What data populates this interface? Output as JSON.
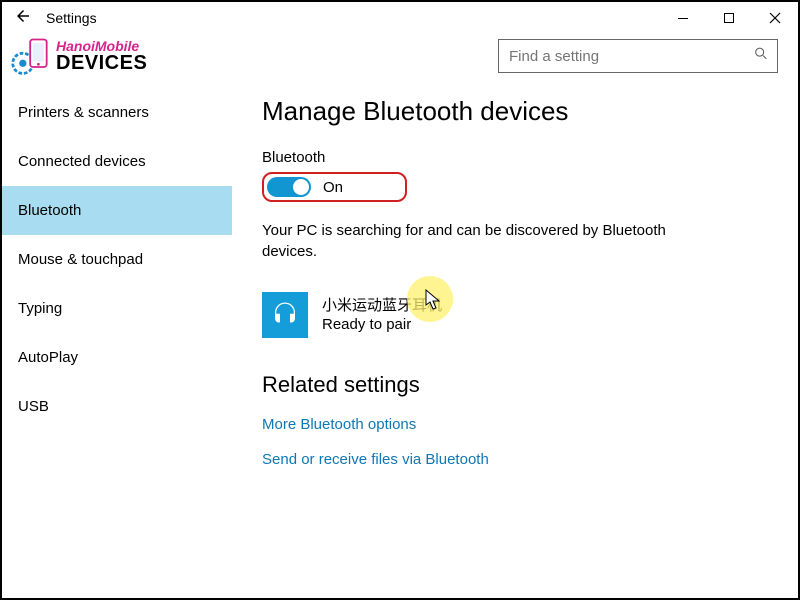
{
  "window": {
    "title": "Settings"
  },
  "logo": {
    "brand": "HanoiMobile",
    "section": "DEVICES"
  },
  "search": {
    "placeholder": "Find a setting"
  },
  "sidebar": {
    "items": [
      {
        "label": "Printers & scanners",
        "selected": false
      },
      {
        "label": "Connected devices",
        "selected": false
      },
      {
        "label": "Bluetooth",
        "selected": true
      },
      {
        "label": "Mouse & touchpad",
        "selected": false
      },
      {
        "label": "Typing",
        "selected": false
      },
      {
        "label": "AutoPlay",
        "selected": false
      },
      {
        "label": "USB",
        "selected": false
      }
    ]
  },
  "main": {
    "heading": "Manage Bluetooth devices",
    "toggle_label": "Bluetooth",
    "toggle_state": "On",
    "status": "Your PC is searching for and can be discovered by Bluetooth devices.",
    "device": {
      "name": "小米运动蓝牙耳机",
      "status": "Ready to pair"
    },
    "related_heading": "Related settings",
    "links": {
      "more_options": "More Bluetooth options",
      "send_receive": "Send or receive files via Bluetooth"
    }
  }
}
